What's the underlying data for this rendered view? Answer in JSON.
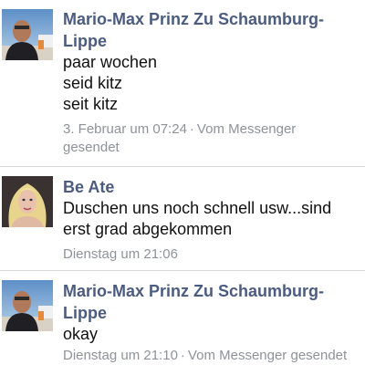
{
  "messages": [
    {
      "sender": "Mario-Max Prinz Zu Schaumburg-Lippe",
      "lines": [
        "paar wochen",
        "seid kitz",
        "seit kitz"
      ],
      "time": "3. Februar um 07:24",
      "separator": "·",
      "via": "Vom Messenger gesendet",
      "avatar": "avatar-man-photo"
    },
    {
      "sender": "Be Ate",
      "lines": [
        "Duschen uns noch schnell usw...sind erst grad abgekommen"
      ],
      "time": "Dienstag um 21:06",
      "avatar": "avatar-woman-blonde-photo"
    },
    {
      "sender": "Mario-Max Prinz Zu Schaumburg-Lippe",
      "lines": [
        "okay"
      ],
      "time": "Dienstag um 21:10",
      "separator": "·",
      "via": "Vom Messenger gesendet",
      "avatar": "avatar-man-photo"
    }
  ],
  "colors": {
    "sender_name": "#4b5c80",
    "message_text": "#111111",
    "meta_text": "#8e939a",
    "divider": "#d6d8dc"
  }
}
